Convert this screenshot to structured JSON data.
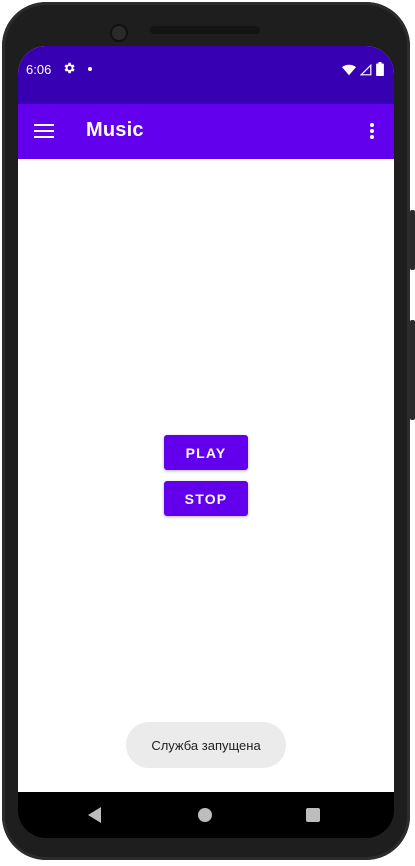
{
  "status_bar": {
    "time": "6:06",
    "icons": [
      "settings-gear-icon",
      "notification-dot-icon",
      "wifi-icon",
      "signal-icon",
      "battery-icon"
    ]
  },
  "app_bar": {
    "title": "Music",
    "background_color": "#6200ee",
    "menu_icon": "hamburger-menu-icon",
    "overflow_icon": "more-vert-icon"
  },
  "main": {
    "play_label": "PLAY",
    "stop_label": "STOP",
    "button_color": "#6200ee"
  },
  "toast": {
    "message": "Служба запущена"
  },
  "theme": {
    "status_bar_color": "#3700b3",
    "primary": "#6200ee"
  }
}
